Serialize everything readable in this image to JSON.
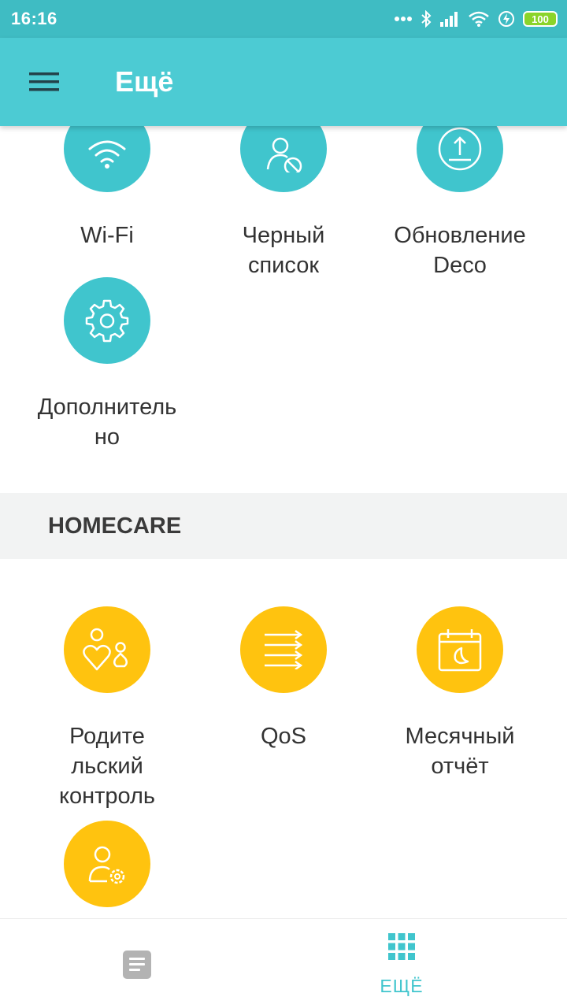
{
  "status_bar": {
    "time": "16:16",
    "battery": "100"
  },
  "app_bar": {
    "title": "Ещё",
    "menu_icon": "hamburger-menu-icon"
  },
  "network_items": [
    {
      "label": "Wi-Fi",
      "icon": "wifi-icon"
    },
    {
      "label": "Черный\nсписок",
      "icon": "blacklist-icon"
    },
    {
      "label": "Обновление\nDeco",
      "icon": "firmware-update-icon"
    },
    {
      "label": "Дополнитель\nно",
      "icon": "gear-icon"
    }
  ],
  "homecare": {
    "title": "HOMECARE",
    "items": [
      {
        "label": "Родите\nльский\nконтроль",
        "icon": "parental-control-icon"
      },
      {
        "label": "QoS",
        "icon": "qos-icon"
      },
      {
        "label": "Месячный\nотчёт",
        "icon": "monthly-report-icon"
      },
      {
        "label": "",
        "icon": "user-settings-icon"
      }
    ]
  },
  "bottom_nav": {
    "home_icon": "list-icon",
    "more_label": "ЕЩЁ",
    "more_icon": "grid-icon"
  },
  "colors": {
    "teal": "#4ccbd3",
    "teal_circle": "#40c5cd",
    "yellow": "#ffc30f",
    "status_bar": "#3fbcc3"
  }
}
